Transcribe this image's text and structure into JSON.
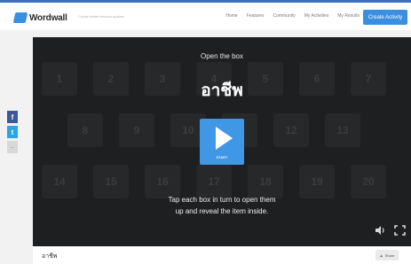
{
  "header": {
    "logo_text": "Wordwall",
    "tagline": "Create better lessons quicker",
    "nav": [
      "Home",
      "Features",
      "Community",
      "My Activities",
      "My Results"
    ],
    "create_label": "Create Activity"
  },
  "game": {
    "title": "Open the box",
    "word": "อาชีพ",
    "start_label": "START",
    "instructions": [
      "Tap each box in turn to open them",
      "up and reveal the item inside."
    ],
    "tiles": [
      "1",
      "2",
      "3",
      "4",
      "5",
      "6",
      "7",
      "8",
      "9",
      "10",
      "11",
      "12",
      "13",
      "14",
      "15",
      "16",
      "17",
      "18",
      "19",
      "20"
    ]
  },
  "share_bar": {
    "facebook": "f",
    "twitter": "t",
    "more": "..."
  },
  "footer": {
    "title": "อาชีพ",
    "share_label": "Share"
  },
  "colors": {
    "accent": "#3b8fe0",
    "game_bg": "#1e1f20",
    "tile_bg": "#272829",
    "start_bg": "#3f97e6"
  }
}
